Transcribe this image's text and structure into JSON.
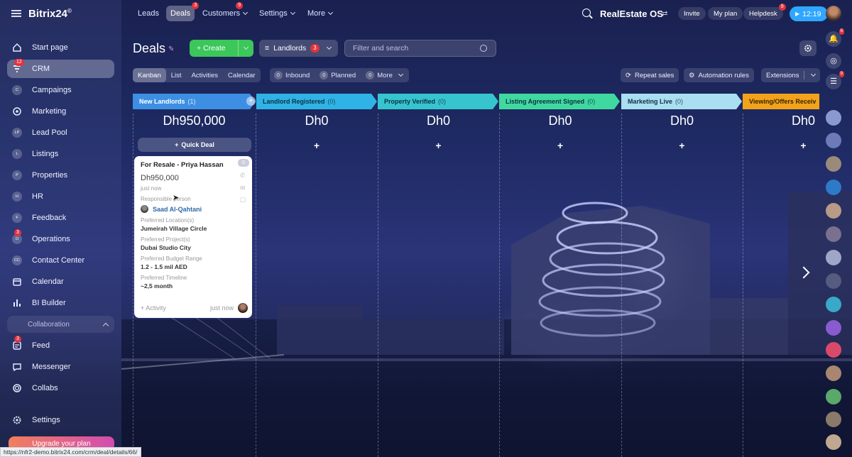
{
  "app": {
    "logo": "Bitrix24",
    "logo_mark": "©"
  },
  "sidebar": {
    "items": [
      {
        "label": "Start page",
        "icon": "home-icon"
      },
      {
        "label": "CRM",
        "icon": "filter-icon",
        "badge": "12"
      },
      {
        "label": "Campaings",
        "icon": "circle-icon",
        "abbr": "C"
      },
      {
        "label": "Marketing",
        "icon": "marketing-icon"
      },
      {
        "label": "Lead Pool",
        "icon": "circle-icon",
        "abbr": "LP"
      },
      {
        "label": "Listings",
        "icon": "circle-icon",
        "abbr": "L"
      },
      {
        "label": "Properties",
        "icon": "circle-icon",
        "abbr": "P"
      },
      {
        "label": "HR",
        "icon": "circle-icon",
        "abbr": "H"
      },
      {
        "label": "Feedback",
        "icon": "circle-icon",
        "abbr": "F"
      },
      {
        "label": "Operations",
        "icon": "circle-icon",
        "abbr": "O",
        "badge": "3"
      },
      {
        "label": "Contact Center",
        "icon": "circle-icon",
        "abbr": "CC"
      },
      {
        "label": "Calendar",
        "icon": "calendar-icon"
      },
      {
        "label": "BI Builder",
        "icon": "chart-icon"
      }
    ],
    "collab_header": "Collaboration",
    "collab_items": [
      {
        "label": "Feed",
        "icon": "feed-icon",
        "badge": "3"
      },
      {
        "label": "Messenger",
        "icon": "chat-icon"
      },
      {
        "label": "Collabs",
        "icon": "collabs-icon"
      }
    ],
    "settings": "Settings",
    "upgrade": "Upgrade your plan"
  },
  "topnav": {
    "tabs": [
      {
        "label": "Leads"
      },
      {
        "label": "Deals",
        "badge": "3",
        "selected": true
      },
      {
        "label": "Customers",
        "badge": "9",
        "dropdown": true
      },
      {
        "label": "Settings",
        "dropdown": true
      },
      {
        "label": "More",
        "dropdown": true
      }
    ],
    "company": "RealEstate OS",
    "invite": "Invite",
    "my_plan": "My plan",
    "helpdesk": "Helpdesk",
    "helpdesk_badge": "9",
    "clock": "12:19"
  },
  "toolbar": {
    "title": "Deals",
    "create": "Create",
    "filter_name": "Landlords",
    "filter_count": "3",
    "search_placeholder": "Filter and search"
  },
  "views": {
    "items": [
      "Kanban",
      "List",
      "Activities",
      "Calendar"
    ],
    "counters": [
      {
        "count": "0",
        "label": "Inbound"
      },
      {
        "count": "0",
        "label": "Planned"
      },
      {
        "count": "0",
        "label": "More"
      }
    ],
    "repeat_sales": "Repeat sales",
    "automation_rules": "Automation rules",
    "extensions": "Extensions"
  },
  "stages": [
    {
      "name": "New Landlords",
      "count": "(1)",
      "sum": "Dh950,000",
      "color": "#3d8fe3"
    },
    {
      "name": "Landlord Registered",
      "count": "(0)",
      "sum": "Dh0",
      "color": "#2fb3e6"
    },
    {
      "name": "Property Verified",
      "count": "(0)",
      "sum": "Dh0",
      "color": "#36c5cf"
    },
    {
      "name": "Listing Agreement Signed",
      "count": "(0)",
      "sum": "Dh0",
      "color": "#3fd9a0"
    },
    {
      "name": "Marketing Live",
      "count": "(0)",
      "sum": "Dh0",
      "color": "#a9dff0"
    },
    {
      "name": "Viewing/Offers Receiv",
      "count": "",
      "sum": "Dh0",
      "color": "#f2a21b"
    }
  ],
  "quick_deal": "Quick Deal",
  "card": {
    "title": "For Resale - Priya Hassan",
    "badge": "0",
    "sum": "Dh950,000",
    "time": "just now",
    "responsible_label": "Responsible person",
    "responsible": "Saad Al-Qahtani",
    "fields": [
      {
        "label": "Preferred Location(s)",
        "value": "Jumeirah Village Circle"
      },
      {
        "label": "Preferred Project(s)",
        "value": "Dubai Studio City"
      },
      {
        "label": "Preferred Budget Range",
        "value": "1.2 - 1.5 mil AED"
      },
      {
        "label": "Preferred Timeline",
        "value": "~2,5 month"
      }
    ],
    "activity": "+ Activity",
    "activity_time": "just now"
  },
  "right_rail": {
    "badges": [
      "6",
      "9"
    ]
  },
  "status_url": "https://nfr2-demo.bitrix24.com/crm/deal/details/66/",
  "colors": {
    "create": "#3bc75a",
    "badge": "#e2323e",
    "clock": "#2fa6ff",
    "link": "#2f6aa8"
  }
}
